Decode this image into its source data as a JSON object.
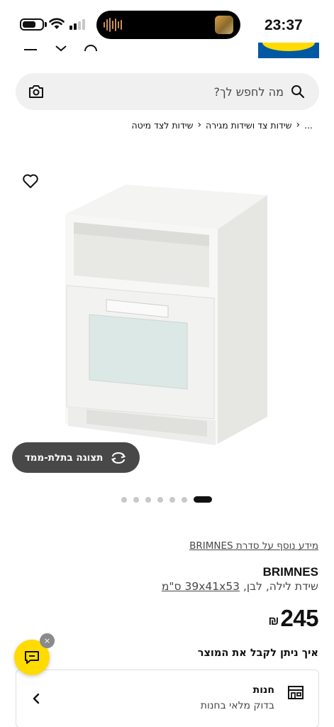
{
  "status_bar": {
    "time": "23:37"
  },
  "search": {
    "placeholder": "מה לחפש לך?"
  },
  "breadcrumb": {
    "ellipsis": "...",
    "items": [
      "שידות צד ושידות מגירה",
      "שידות לצד מיטה"
    ]
  },
  "gallery": {
    "view_3d_label": "תצוגה בתלת-ממד",
    "dot_count": 7,
    "active_dot": 0
  },
  "product": {
    "series_link": "מידע נוסף על סדרת BRIMNES",
    "name": "BRIMNES",
    "description": "שידת לילה, לבן,",
    "dimensions": "39x41x53 ס\"מ",
    "price": "245",
    "currency": "₪"
  },
  "delivery": {
    "title": "איך ניתן לקבל את המוצר",
    "store_title": "חנות",
    "store_subtitle": "בדוק מלאי בחנות"
  },
  "chat": {
    "close_label": "×"
  },
  "colors": {
    "brand_blue": "#0058a3",
    "brand_yellow": "#ffdb00",
    "button_dark": "#484848"
  },
  "icons": [
    "search-icon",
    "camera-icon",
    "heart-icon",
    "rotate-3d-icon",
    "store-icon",
    "chevron-left-icon",
    "chat-icon"
  ]
}
